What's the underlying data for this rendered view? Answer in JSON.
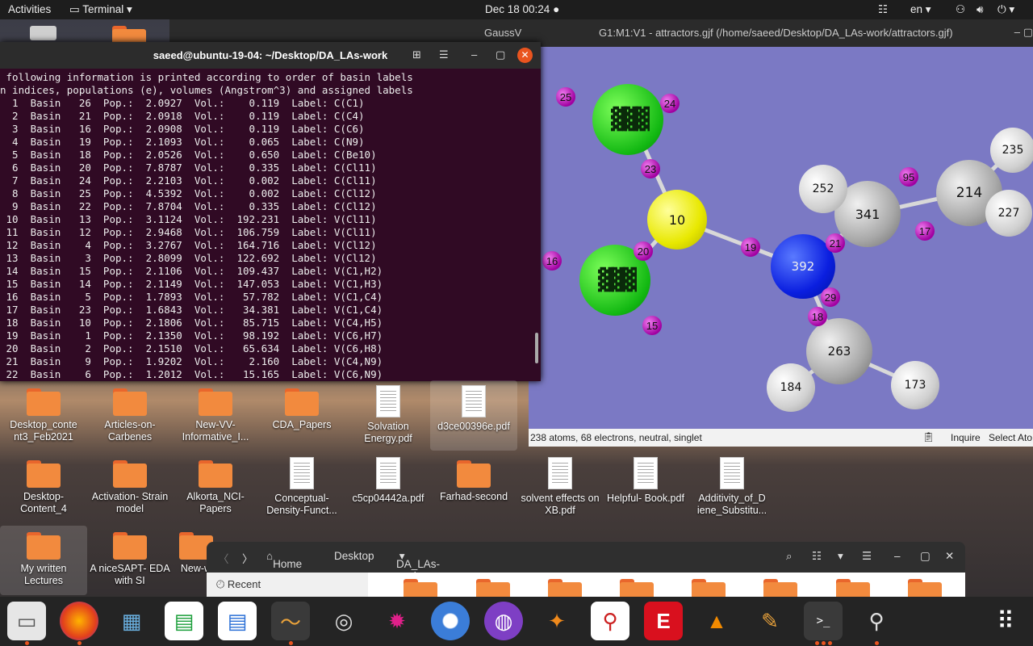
{
  "topbar": {
    "activities": "Activities",
    "app_menu": "Terminal",
    "clock": "Dec 18  00:24",
    "lang": "en"
  },
  "gaussview": {
    "app_label": "GaussV",
    "window_title": "G1:M1:V1 - attractors.gjf (/home/saeed/Desktop/DA_LAs-work/attractors.gjf)",
    "status": "238 atoms, 68 electrons, neutral, singlet",
    "status_right1": "Inquire",
    "status_right2": "Select Ato",
    "atoms": [
      "10",
      "392",
      "341",
      "214",
      "252",
      "235",
      "227",
      "263",
      "184",
      "173"
    ],
    "crit_points": [
      "25",
      "24",
      "23",
      "20",
      "19",
      "16",
      "15",
      "21",
      "29",
      "18",
      "17",
      "95"
    ]
  },
  "terminal": {
    "title": "saeed@ubuntu-19-04: ~/Desktop/DA_LAs-work",
    "lines": [
      " following information is printed according to order of basin labels",
      "n indices, populations (e), volumes (Angstrom^3) and assigned labels",
      "  1  Basin   26  Pop.:  2.0927  Vol.:    0.119  Label: C(C1)",
      "  2  Basin   21  Pop.:  2.0918  Vol.:    0.119  Label: C(C4)",
      "  3  Basin   16  Pop.:  2.0908  Vol.:    0.119  Label: C(C6)",
      "  4  Basin   19  Pop.:  2.1093  Vol.:    0.065  Label: C(N9)",
      "  5  Basin   18  Pop.:  2.0526  Vol.:    0.650  Label: C(Be10)",
      "  6  Basin   20  Pop.:  7.8787  Vol.:    0.335  Label: C(Cl11)",
      "  7  Basin   24  Pop.:  2.2103  Vol.:    0.002  Label: C(Cl11)",
      "  8  Basin   25  Pop.:  4.5392  Vol.:    0.002  Label: C(Cl12)",
      "  9  Basin   22  Pop.:  7.8704  Vol.:    0.335  Label: C(Cl12)",
      " 10  Basin   13  Pop.:  3.1124  Vol.:  192.231  Label: V(Cl11)",
      " 11  Basin   12  Pop.:  2.9468  Vol.:  106.759  Label: V(Cl11)",
      " 12  Basin    4  Pop.:  3.2767  Vol.:  164.716  Label: V(Cl12)",
      " 13  Basin    3  Pop.:  2.8099  Vol.:  122.692  Label: V(Cl12)",
      " 14  Basin   15  Pop.:  2.1106  Vol.:  109.437  Label: V(C1,H2)",
      " 15  Basin   14  Pop.:  2.1149  Vol.:  147.053  Label: V(C1,H3)",
      " 16  Basin    5  Pop.:  1.7893  Vol.:   57.782  Label: V(C1,C4)",
      " 17  Basin   23  Pop.:  1.6843  Vol.:   34.381  Label: V(C1,C4)",
      " 18  Basin   10  Pop.:  2.1806  Vol.:   85.715  Label: V(C4,H5)",
      " 19  Basin    1  Pop.:  2.1350  Vol.:   98.192  Label: V(C6,H7)",
      " 20  Basin    2  Pop.:  2.1510  Vol.:   65.634  Label: V(C6,H8)",
      " 21  Basin    9  Pop.:  1.9202  Vol.:    2.160  Label: V(C4,N9)",
      " 22  Basin    6  Pop.:  1.2012  Vol.:   15.165  Label: V(C6,N9)"
    ]
  },
  "desktop": {
    "row1": [
      "Desktop_conte nt3_Feb2021",
      "Articles-on- Carbenes",
      "New-VV- Informative_I...",
      "CDA_Papers",
      "Solvation Energy.pdf",
      "d3ce00396e.pdf"
    ],
    "row2": [
      "Desktop- Content_4",
      "Activation- Strain model",
      "Alkorta_NCI- Papers",
      "Conceptual- Density-Funct...",
      "c5cp04442a.pdf",
      "Farhad-second",
      "solvent effects on XB.pdf",
      "Helpful- Book.pdf",
      "Additivity_of_D iene_Substitu..."
    ],
    "row3": [
      "My written Lectures",
      "A niceSAPT- EDA with SI",
      "New-w"
    ]
  },
  "files": {
    "crumbs": [
      "Home",
      "Desktop",
      "DA_LAs-work"
    ],
    "recent": "Recent"
  },
  "dock": {
    "apps": [
      "files-icon",
      "firefox-icon",
      "chemcraft-icon",
      "calc-icon",
      "writer-icon",
      "monitor-icon",
      "gaussian-icon",
      "avogadro-icon",
      "chromium-icon",
      "tor-icon",
      "molden-icon",
      "iqmol-icon",
      "editor-icon",
      "vlc-icon",
      "paint-icon",
      "terminal-icon",
      "gaussview-icon",
      "app-grid-icon"
    ]
  }
}
